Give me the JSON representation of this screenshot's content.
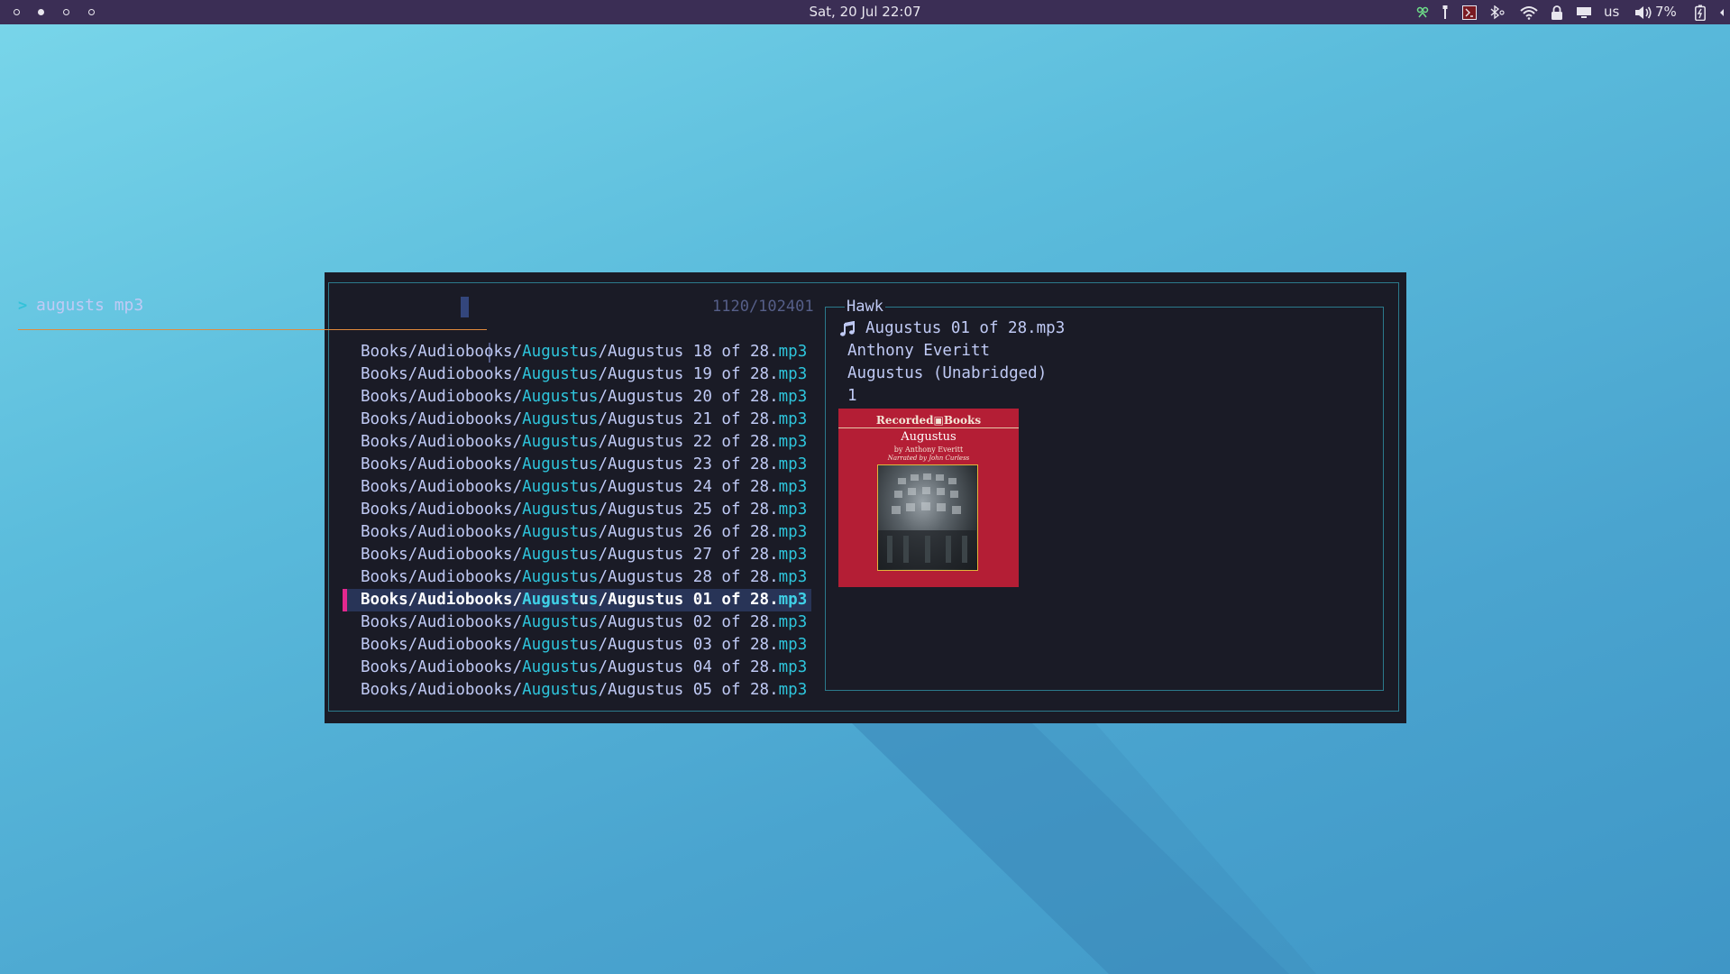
{
  "topbar": {
    "workspaces": [
      {
        "active": false
      },
      {
        "active": true
      },
      {
        "active": false
      },
      {
        "active": false
      }
    ],
    "clock": "Sat, 20 Jul 22:07",
    "keyboard_layout": "us",
    "volume": "7%",
    "tray_icons": [
      "app-tray-icon",
      "usb-icon",
      "terminal-tray-icon",
      "bluetooth-icon",
      "wifi-icon",
      "lock-icon",
      "display-icon",
      "volume-icon",
      "battery-charging-icon"
    ]
  },
  "finder": {
    "prompt": ">",
    "query": "augusts mp3",
    "match_count": "1120/102401",
    "results": [
      {
        "prefix": "Books/Audiobooks/",
        "m1": "August",
        "mid": "u",
        "m2": "s",
        "rest": "/Augustus 18 of 28.",
        "ext": "mp3",
        "selected": false
      },
      {
        "prefix": "Books/Audiobooks/",
        "m1": "August",
        "mid": "u",
        "m2": "s",
        "rest": "/Augustus 19 of 28.",
        "ext": "mp3",
        "selected": false
      },
      {
        "prefix": "Books/Audiobooks/",
        "m1": "August",
        "mid": "u",
        "m2": "s",
        "rest": "/Augustus 20 of 28.",
        "ext": "mp3",
        "selected": false
      },
      {
        "prefix": "Books/Audiobooks/",
        "m1": "August",
        "mid": "u",
        "m2": "s",
        "rest": "/Augustus 21 of 28.",
        "ext": "mp3",
        "selected": false
      },
      {
        "prefix": "Books/Audiobooks/",
        "m1": "August",
        "mid": "u",
        "m2": "s",
        "rest": "/Augustus 22 of 28.",
        "ext": "mp3",
        "selected": false
      },
      {
        "prefix": "Books/Audiobooks/",
        "m1": "August",
        "mid": "u",
        "m2": "s",
        "rest": "/Augustus 23 of 28.",
        "ext": "mp3",
        "selected": false
      },
      {
        "prefix": "Books/Audiobooks/",
        "m1": "August",
        "mid": "u",
        "m2": "s",
        "rest": "/Augustus 24 of 28.",
        "ext": "mp3",
        "selected": false
      },
      {
        "prefix": "Books/Audiobooks/",
        "m1": "August",
        "mid": "u",
        "m2": "s",
        "rest": "/Augustus 25 of 28.",
        "ext": "mp3",
        "selected": false
      },
      {
        "prefix": "Books/Audiobooks/",
        "m1": "August",
        "mid": "u",
        "m2": "s",
        "rest": "/Augustus 26 of 28.",
        "ext": "mp3",
        "selected": false
      },
      {
        "prefix": "Books/Audiobooks/",
        "m1": "August",
        "mid": "u",
        "m2": "s",
        "rest": "/Augustus 27 of 28.",
        "ext": "mp3",
        "selected": false
      },
      {
        "prefix": "Books/Audiobooks/",
        "m1": "August",
        "mid": "u",
        "m2": "s",
        "rest": "/Augustus 28 of 28.",
        "ext": "mp3",
        "selected": false
      },
      {
        "prefix": "Books/Audiobooks/",
        "m1": "August",
        "mid": "u",
        "m2": "s",
        "rest": "/Augustus 01 of 28.",
        "ext": "mp3",
        "selected": true
      },
      {
        "prefix": "Books/Audiobooks/",
        "m1": "August",
        "mid": "u",
        "m2": "s",
        "rest": "/Augustus 02 of 28.",
        "ext": "mp3",
        "selected": false
      },
      {
        "prefix": "Books/Audiobooks/",
        "m1": "August",
        "mid": "u",
        "m2": "s",
        "rest": "/Augustus 03 of 28.",
        "ext": "mp3",
        "selected": false
      },
      {
        "prefix": "Books/Audiobooks/",
        "m1": "August",
        "mid": "u",
        "m2": "s",
        "rest": "/Augustus 04 of 28.",
        "ext": "mp3",
        "selected": false
      },
      {
        "prefix": "Books/Audiobooks/",
        "m1": "August",
        "mid": "u",
        "m2": "s",
        "rest": "/Augustus 05 of 28.",
        "ext": "mp3",
        "selected": false
      }
    ]
  },
  "preview": {
    "title": "Hawk",
    "filename": "Augustus 01 of 28.mp3",
    "artist": "Anthony Everitt",
    "album": "Augustus (Unabridged)",
    "track": "1",
    "cover": {
      "publisher": "Recorded▣Books",
      "title": "Augustus",
      "author": "by Anthony Everitt",
      "narrator": "Narrated by John Curless"
    }
  },
  "colors": {
    "bar_bg": "#3b2e55",
    "terminal_bg": "#1a1b26",
    "match": "#2ec5dc",
    "selection_marker": "#e2288e",
    "separator": "#e08a3c",
    "cover_red": "#b41e35"
  }
}
